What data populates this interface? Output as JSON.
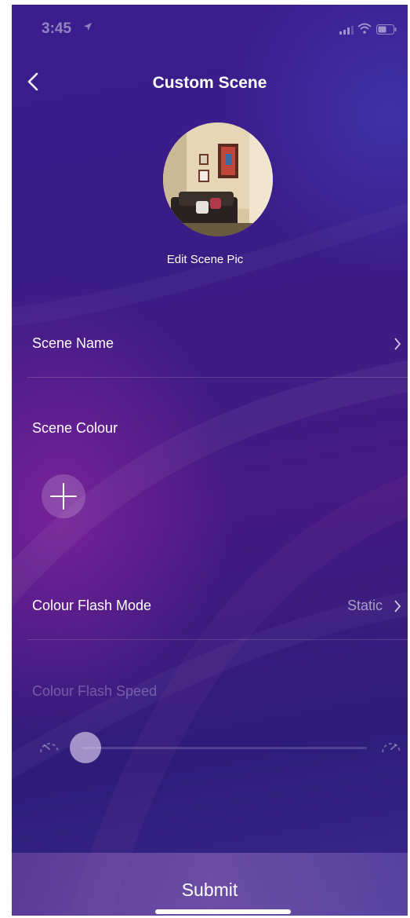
{
  "status_bar": {
    "time": "3:45",
    "icons": [
      "location-arrow-icon",
      "signal-icon",
      "wifi-icon",
      "battery-icon"
    ]
  },
  "nav": {
    "back_icon": "chevron-left-icon",
    "title": "Custom Scene"
  },
  "scene_pic": {
    "edit_label": "Edit Scene Pic"
  },
  "settings": {
    "scene_name": {
      "label": "Scene Name"
    },
    "scene_colour": {
      "label": "Scene Colour",
      "add_icon": "plus-icon"
    },
    "flash_mode": {
      "label": "Colour Flash Mode",
      "value": "Static"
    },
    "flash_speed": {
      "label": "Colour Flash Speed",
      "slider_value": 0.0
    }
  },
  "submit_label": "Submit",
  "colors": {
    "background_primary": "#3a1e8e",
    "background_accent": "#a028aa",
    "text": "#ffffff"
  }
}
